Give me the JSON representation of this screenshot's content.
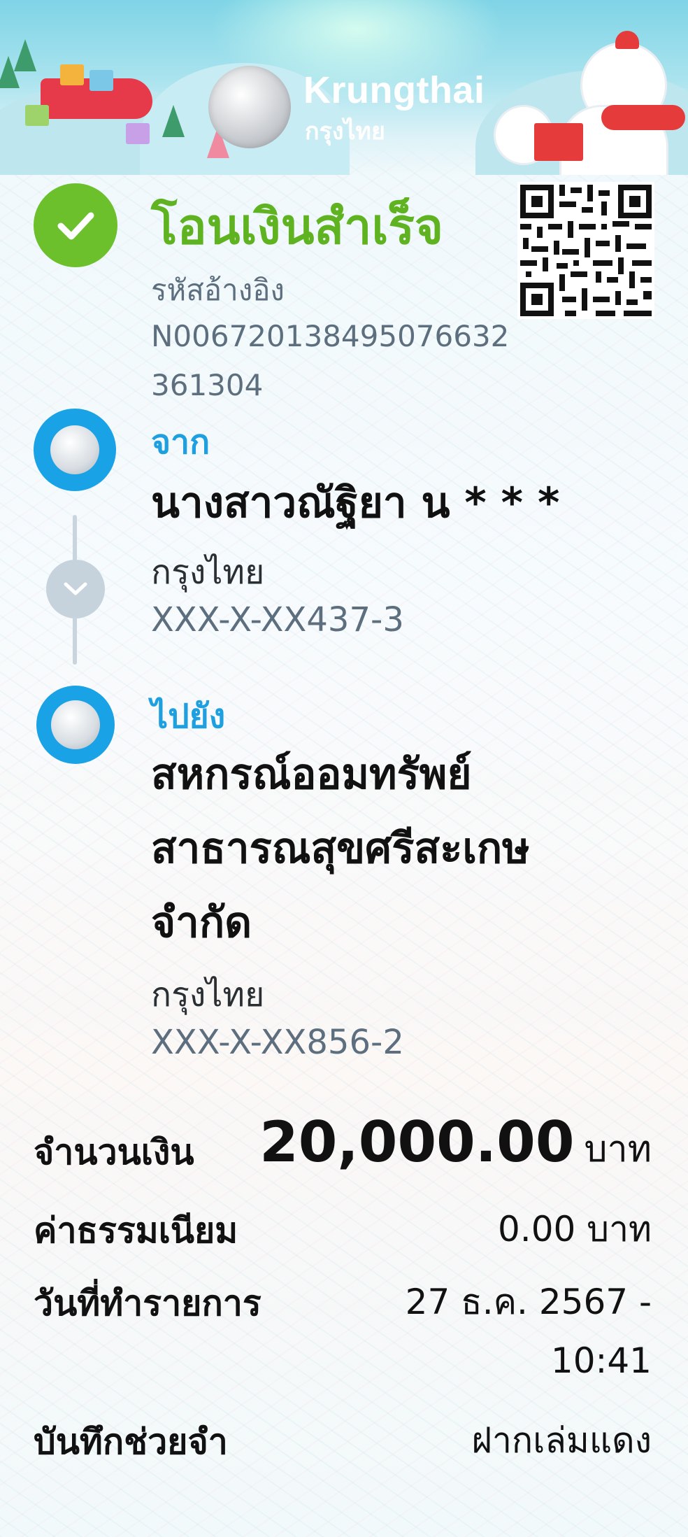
{
  "header": {
    "brand_en": "Krungthai",
    "brand_th": "กรุงไทย"
  },
  "status": {
    "title": "โอนเงินสำเร็จ",
    "ref_label": "รหัสอ้างอิง",
    "ref_value": "N006720138495076632361304"
  },
  "from": {
    "label": "จาก",
    "name": "นางสาวณัฐิยา น * * *",
    "bank": "กรุงไทย",
    "account": "XXX-X-XX437-3"
  },
  "to": {
    "label": "ไปยัง",
    "name": "สหกรณ์ออมทรัพย์สาธารณสุขศรีสะเกษจำกัด",
    "bank": "กรุงไทย",
    "account": "XXX-X-XX856-2"
  },
  "details": {
    "amount_label": "จำนวนเงิน",
    "amount_value": "20,000.00",
    "amount_unit": "บาท",
    "fee_label": "ค่าธรรมเนียม",
    "fee_value": "0.00 บาท",
    "date_label": "วันที่ทำรายการ",
    "date_value_line1": "27 ธ.ค. 2567 -",
    "date_value_line2": "10:41",
    "memo_label": "บันทึกช่วยจำ",
    "memo_value": "ฝากเล่มแดง"
  },
  "colors": {
    "success_green": "#6cc02c",
    "brand_blue": "#1aa2e6"
  },
  "icons": {
    "success": "check-icon",
    "qr": "qr-code-icon",
    "bank": "krungthai-logo-icon",
    "connector": "chevron-down-icon"
  }
}
